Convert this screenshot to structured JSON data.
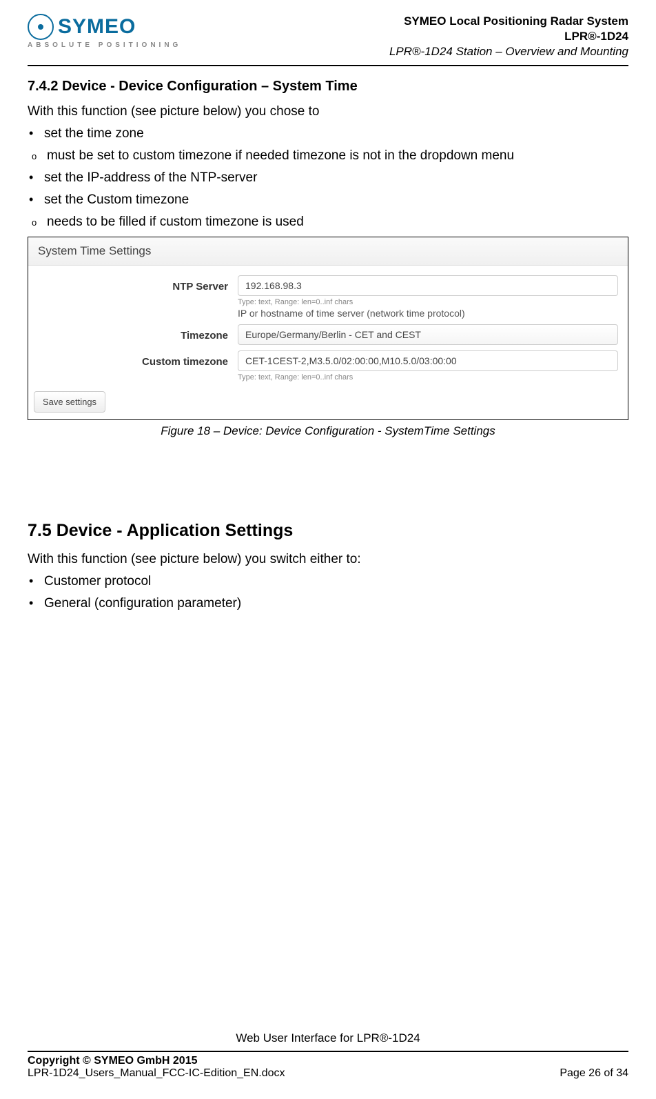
{
  "header": {
    "logo_text": "SYMEO",
    "logo_sub": "ABSOLUTE POSITIONING",
    "line1": "SYMEO Local Positioning Radar System",
    "line2": "LPR®-1D24",
    "line3": "LPR®-1D24 Station – Overview and Mounting"
  },
  "section_742": {
    "number_title": "7.4.2   Device - Device Configuration – System Time",
    "intro": "With this function (see picture below) you chose to",
    "b1": "set the time zone",
    "b1s": "must be set to custom timezone if needed timezone is not in the dropdown menu",
    "b2": "set the IP-address of the NTP-server",
    "b3": "set the Custom timezone",
    "b3s": "needs to be filled if custom timezone is used"
  },
  "screenshot": {
    "panel_title": "System Time Settings",
    "ntp_label": "NTP Server",
    "ntp_value": "192.168.98.3",
    "ntp_hint": "Type: text, Range: len=0..inf chars",
    "ntp_help": "IP or hostname of time server (network time protocol)",
    "tz_label": "Timezone",
    "tz_value": "Europe/Germany/Berlin - CET and CEST",
    "ctz_label": "Custom timezone",
    "ctz_value": "CET-1CEST-2,M3.5.0/02:00:00,M10.5.0/03:00:00",
    "ctz_hint": "Type: text, Range: len=0..inf chars",
    "save": "Save settings"
  },
  "caption": "Figure 18 – Device: Device Configuration - SystemTime Settings",
  "section_75": {
    "number_title": "7.5        Device - Application Settings",
    "intro": "With this function (see picture below) you switch either to:",
    "b1": "Customer protocol",
    "b2": "General (configuration parameter)"
  },
  "footer": {
    "center": "Web User Interface for LPR®-1D24",
    "copyright": "Copyright © SYMEO GmbH 2015",
    "filename": "LPR-1D24_Users_Manual_FCC-IC-Edition_EN.docx",
    "page": "Page 26 of 34"
  }
}
